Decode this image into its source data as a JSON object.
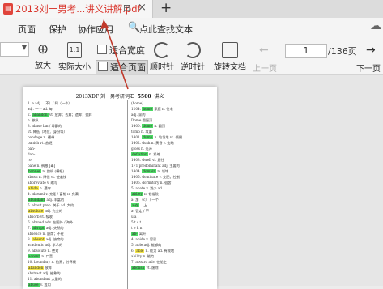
{
  "tab": {
    "title": "2013刘一男考...讲义讲解.pdf",
    "file_icon": "pdf-file-icon",
    "pin_icon": "pin-icon",
    "close_icon": "close-icon",
    "new_tab_icon": "plus-icon"
  },
  "menubar": {
    "items": [
      "页面",
      "保护",
      "协作应用"
    ],
    "search_text": "点此查找文本",
    "search_icon": "search-icon",
    "cloud_icon": "cloud-icon"
  },
  "toolbar": {
    "zoom_in": "放大",
    "actual_size": "实际大小",
    "actual_size_icon_text": "1:1",
    "fit_width": "适合宽度",
    "fit_page": "适合页面",
    "rotate_cw": "顺时针",
    "rotate_ccw": "逆时针",
    "rotate_doc": "旋转文档",
    "prev_page": "上一页",
    "next_page": "下一页",
    "current_page": "1",
    "total_pages": "/136页"
  },
  "document": {
    "title_left": "2013XDF  刘一男考研词汇",
    "title_num": "5500",
    "title_right": "讲义",
    "left_lines": [
      {
        "t": "1.  a       adj. （不）/ 阿（一个）"
      },
      {
        "t": "   adj. 一个   ad. 每"
      },
      {
        "t": "2.  abandon    vt. 放弃；丢弃；遗弃；抛弃",
        "h": "abandon",
        "c": "g"
      },
      {
        "t": "   n. 放纵"
      },
      {
        "t": "3.  abase  ban/ 卑鄙的"
      },
      {
        "t": "   vt. 降低（地位、身份等）"
      },
      {
        "t": "   bandage  n. 绷带"
      },
      {
        "t": "   banish   vt. 放逐"
      },
      {
        "t": "   ban-"
      },
      {
        "t": "   dan-"
      },
      {
        "t": "   ro-"
      },
      {
        "t": "   bane  n. 祸根 [毒]"
      },
      {
        "t": "   banner   n. 旗帜 (横幅)",
        "h": "banner",
        "c": "g"
      },
      {
        "t": "   abash  n. 降低 vt. 使羞愧"
      },
      {
        "t": "   abbreviate  v. 缩写"
      },
      {
        "t": "   abide  n. 遵守",
        "h": "abide",
        "c": "y"
      },
      {
        "t": "4.  abound  v. 充足 / 富裕   n. 充满"
      },
      {
        "t": "   abundant  adj. 丰富的",
        "h": "abundant",
        "c": "g"
      },
      {
        "t": "5.  about  prep. 关于 ad. 大约"
      },
      {
        "t": "   absolute  adj. 完全的",
        "h": "absolute",
        "c": "y"
      },
      {
        "t": "   absorb  vt. 吸收"
      },
      {
        "t": "6.  abroad  adv. 在国外 / 海外"
      },
      {
        "t": "7.  abrupt  adj. 突然的",
        "h": "abrupt",
        "c": "g"
      },
      {
        "t": "   absence  n. 缺席；不在"
      },
      {
        "t": "8.  absent  adj. 缺席的",
        "h": "absent",
        "c": "y"
      },
      {
        "t": "   academic  adj. 学术的"
      },
      {
        "t": "9.  absolute  n. 绝对"
      },
      {
        "t": "   accent  n. 口音",
        "h": "accent",
        "c": "g"
      },
      {
        "t": "10. boundary  n. 边界；分界线"
      },
      {
        "t": "   abandon  放弃",
        "h": "abandon",
        "c": "y"
      },
      {
        "t": "   abstract  adj. 抽象的"
      },
      {
        "t": "11. abundant  大量的"
      },
      {
        "t": "   abuse  v. 滥用",
        "h": "abuse",
        "c": "g"
      }
    ],
    "right_lines": [
      {
        "t": "   (home)"
      },
      {
        "t": "1204. home  家庭 n. 住宅",
        "h": "home",
        "c": "g"
      },
      {
        "t": "   adj. 家的"
      },
      {
        "t": "   Dome  圆屋顶"
      },
      {
        "t": "1400. dome  n. 圆顶",
        "h": "dome",
        "c": "g"
      },
      {
        "t": "   tomb  n. 坟墓"
      },
      {
        "t": "1401. dump  n. 垃圾堆 vt. 倾倒",
        "h": "dump",
        "c": "g"
      },
      {
        "t": "1402. dusk  n. 黄昏 v. 变暗"
      },
      {
        "t": "   gloss  n. 光泽"
      },
      {
        "t": "   deflation  n. 紧缩",
        "h": "deflation",
        "c": "g"
      },
      {
        "t": "   1403. dwell  vi. 居住"
      },
      {
        "t": "1F1  predominant  adj. 主要的"
      },
      {
        "t": "1404. domain  n. 领域",
        "h": "domain",
        "c": "g"
      },
      {
        "t": "1405. dominate  v. 支配；控制"
      },
      {
        "t": "1406. dormitory  n. 宿舍"
      },
      {
        "t": "5.  abate  v. 减少  ad."
      },
      {
        "t": "   abbey  n. 修道院",
        "h": "abbey",
        "c": "g"
      },
      {
        "t": "   a- 加 （c） / 一个"
      },
      {
        "t": "   a-在... 上",
        "h": "a-在",
        "c": "g"
      },
      {
        "t": "   a-  否定 / 不"
      },
      {
        "t": "   u a  l"
      },
      {
        "t": "   5  t  s  t"
      },
      {
        "t": "   t  e  k  n"
      },
      {
        "t": "   ab-  离开",
        "h": "ab-",
        "c": "g"
      },
      {
        "t": "   4.  abide  v. 容忍"
      },
      {
        "t": "   5.  able  adj. 能够的"
      },
      {
        "t": "6.  able  n. 能力  ad. 有效地",
        "h": "able",
        "c": "y"
      },
      {
        "t": "   ability  n. 能力"
      },
      {
        "t": "7.  aboard  adv. 在船上"
      },
      {
        "t": "   abolish  vt. 废除",
        "h": "abolish",
        "c": "g"
      }
    ]
  }
}
